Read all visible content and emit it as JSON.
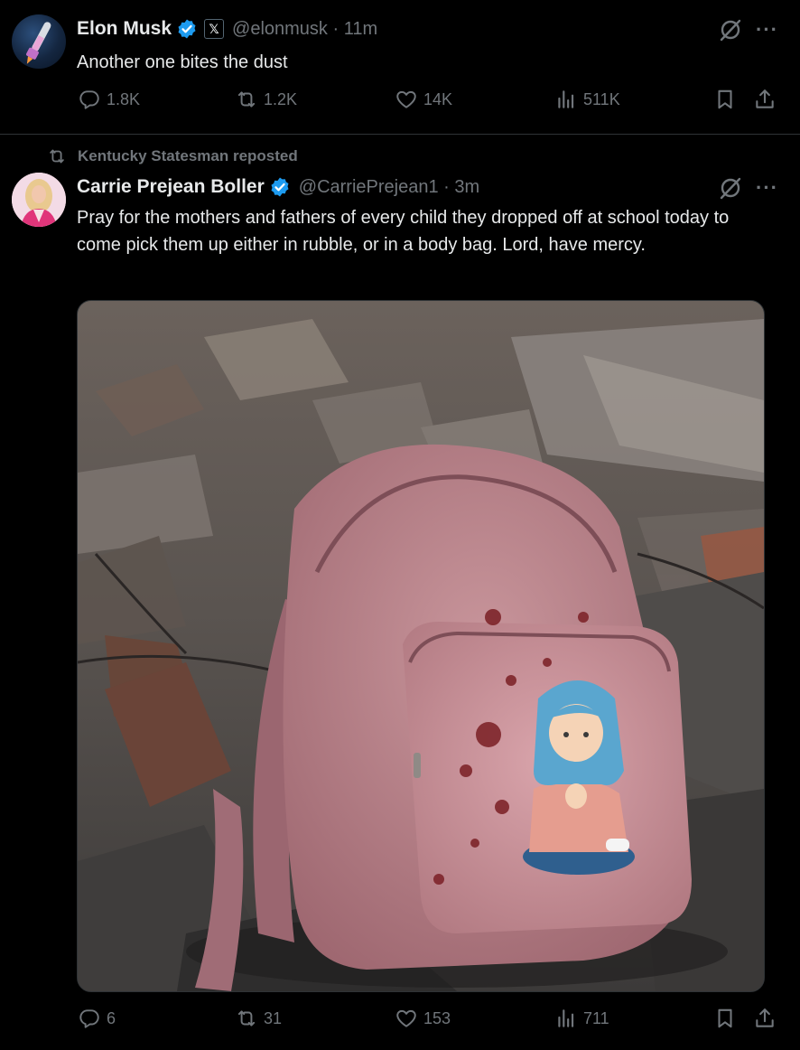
{
  "tweet1": {
    "display_name": "Elon Musk",
    "affiliation_badge": "𝕏",
    "handle_time": "@elonmusk · 11m",
    "text": "Another one bites the dust",
    "stats": {
      "replies": "1.8K",
      "reposts": "1.2K",
      "likes": "14K",
      "views": "511K"
    }
  },
  "tweet2": {
    "repost_label": "Kentucky Statesman reposted",
    "display_name": "Carrie Prejean Boller",
    "handle_time": "@CarriePrejean1 · 3m",
    "text": "Pray for the mothers and fathers of every child they dropped off at school today to come pick them up either in rubble, or in a body bag. Lord, have mercy.",
    "stats": {
      "replies": "6",
      "reposts": "31",
      "likes": "153",
      "views": "711"
    }
  },
  "more_glyph": "···",
  "colors": {
    "background": "#000000",
    "text_primary": "#e7e9ea",
    "text_secondary": "#71767b",
    "verified_blue": "#1d9bf0",
    "divider": "#2f3336"
  }
}
